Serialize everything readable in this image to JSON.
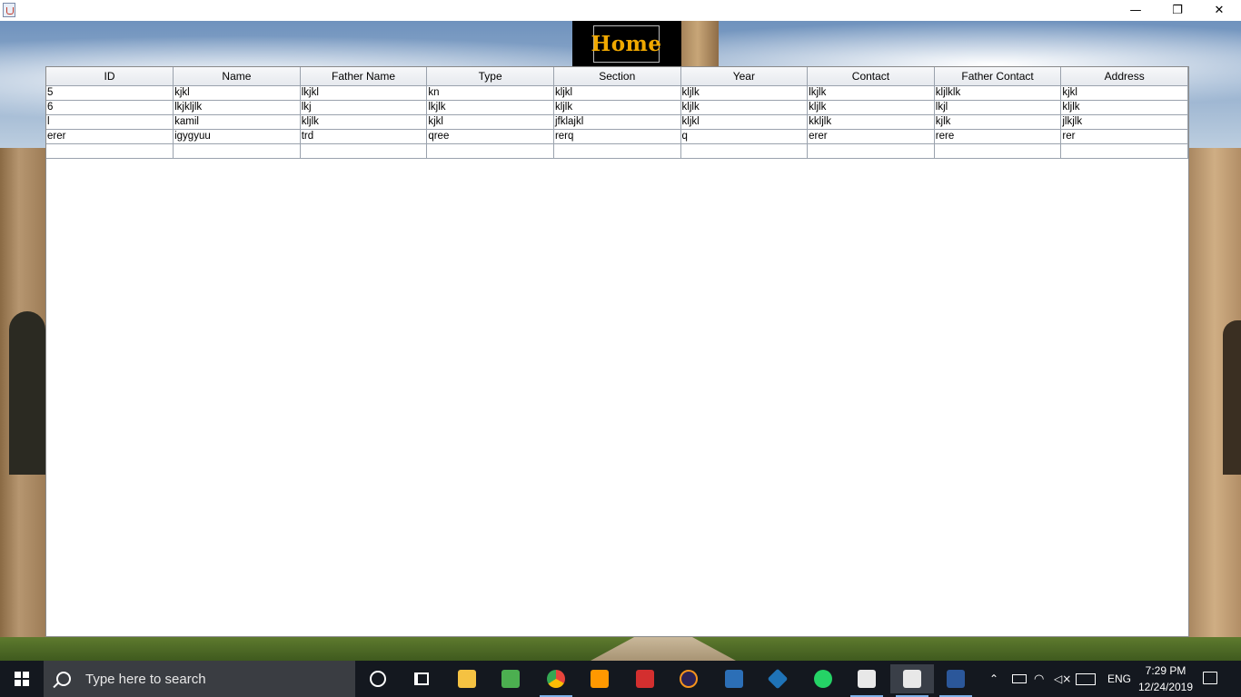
{
  "window": {
    "minimize_glyph": "—",
    "maximize_glyph": "❐",
    "close_glyph": "✕"
  },
  "home": {
    "label": "Home"
  },
  "table": {
    "columns": [
      "ID",
      "Name",
      "Father Name",
      "Type",
      "Section",
      "Year",
      "Contact",
      "Father Contact",
      "Address"
    ],
    "rows": [
      [
        "5",
        "kjkl",
        "lkjkl",
        "kn",
        "kljkl",
        "kljlk",
        "lkjlk",
        "kljlklk",
        "kjkl"
      ],
      [
        "6",
        "lkjkljlk",
        "lkj",
        "lkjlk",
        "kljlk",
        "kljlk",
        "kljlk",
        "lkjl",
        "kljlk"
      ],
      [
        "l",
        "kamil",
        "kljlk",
        "kjkl",
        "jfklajkl",
        "kljkl",
        "kkljlk",
        "kjlk",
        "jlkjlk"
      ],
      [
        "erer",
        "igygyuu",
        "trd",
        "qree",
        "rerq",
        "q",
        "erer",
        "rere",
        "rer"
      ],
      [
        "",
        "",
        "",
        "",
        "",
        "",
        "",
        "",
        ""
      ]
    ]
  },
  "taskbar": {
    "search_placeholder": "Type here to search",
    "language": "ENG",
    "time": "7:29 PM",
    "date": "12/24/2019",
    "apps": [
      "cortana-icon",
      "task-view-icon",
      "file-explorer-icon",
      "notepad-icon",
      "chrome-icon",
      "sublime-text-icon",
      "acrobat-icon",
      "eclipse-icon",
      "dev-cpp-icon",
      "virtualbox-icon",
      "whatsapp-icon",
      "java-icon",
      "java-icon",
      "word-icon"
    ],
    "tray_icons": [
      "chevron-up-icon",
      "battery-icon",
      "wifi-icon",
      "volume-muted-icon",
      "keyboard-icon"
    ],
    "colors": {
      "chrome": "#e8453c",
      "sublime": "#ff9800",
      "acrobat": "#d32f2f",
      "eclipse": "#2c2255",
      "devcpp": "#2c6fb7",
      "virtualbox": "#1f73b7",
      "whatsapp": "#25d366",
      "word": "#2b579a",
      "explorer": "#f5c242",
      "notepad": "#4caf50"
    }
  }
}
